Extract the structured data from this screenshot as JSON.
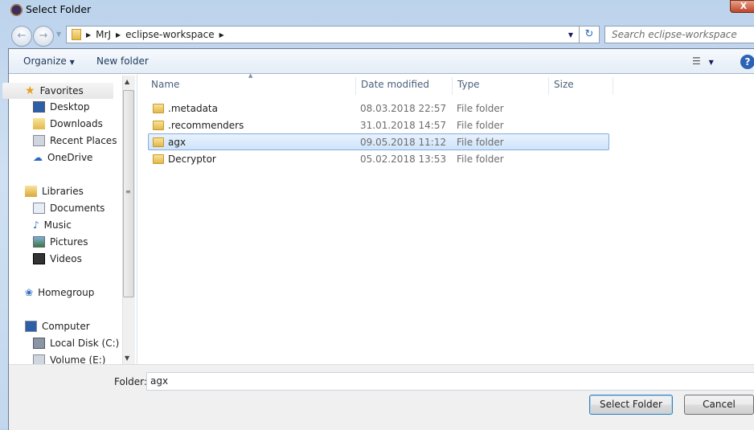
{
  "window": {
    "title": "Select Folder",
    "close_label": "X"
  },
  "address": {
    "crumbs": [
      "MrJ",
      "eclipse-workspace"
    ],
    "search_placeholder": "Search eclipse-workspace"
  },
  "toolbar": {
    "organize": "Organize",
    "new_folder": "New folder"
  },
  "nav": {
    "favorites": "Favorites",
    "favorite_items": [
      "Desktop",
      "Downloads",
      "Recent Places",
      "OneDrive"
    ],
    "libraries": "Libraries",
    "library_items": [
      "Documents",
      "Music",
      "Pictures",
      "Videos"
    ],
    "homegroup": "Homegroup",
    "computer": "Computer",
    "computer_items": [
      "Local Disk (C:)",
      "Volume (E:)"
    ]
  },
  "columns": [
    "Name",
    "Date modified",
    "Type",
    "Size"
  ],
  "rows": [
    {
      "name": ".metadata",
      "date": "08.03.2018 22:57",
      "type": "File folder",
      "selected": false
    },
    {
      "name": ".recommenders",
      "date": "31.01.2018 14:57",
      "type": "File folder",
      "selected": false
    },
    {
      "name": "agx",
      "date": "09.05.2018 11:12",
      "type": "File folder",
      "selected": true
    },
    {
      "name": "Decryptor",
      "date": "05.02.2018 13:53",
      "type": "File folder",
      "selected": false
    }
  ],
  "footer": {
    "folder_label": "Folder:",
    "folder_value": "agx",
    "select_button": "Select Folder",
    "cancel_button": "Cancel"
  }
}
